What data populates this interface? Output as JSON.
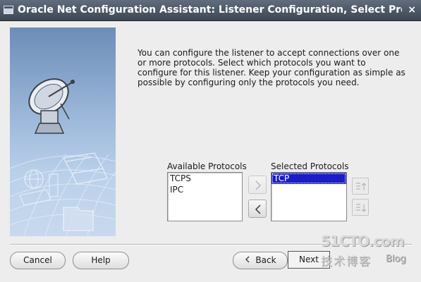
{
  "window": {
    "title": "Oracle Net Configuration Assistant: Listener Configuration, Select Protocols",
    "close_glyph": "×"
  },
  "intro_text": "You can configure the listener to accept connections over one or more protocols. Select which protocols you want to configure for this listener. Keep your configuration as simple as possible by configuring only the protocols you need.",
  "available": {
    "label": "Available Protocols",
    "items": [
      "TCPS",
      "IPC"
    ]
  },
  "selected": {
    "label": "Selected Protocols",
    "items": [
      "TCP"
    ],
    "selected_index": 0
  },
  "buttons": {
    "cancel": "Cancel",
    "help": "Help",
    "back": "Back",
    "next": "Next"
  },
  "watermark": {
    "site": "51CTO.com",
    "sub": "技术博客",
    "blog": "Blog"
  },
  "icons": {
    "satellite": "satellite-dish-icon",
    "move_right": "arrow-right-icon",
    "move_left": "arrow-left-icon",
    "move_up": "move-up-icon",
    "move_down": "move-down-icon",
    "back": "arrow-left-icon"
  }
}
